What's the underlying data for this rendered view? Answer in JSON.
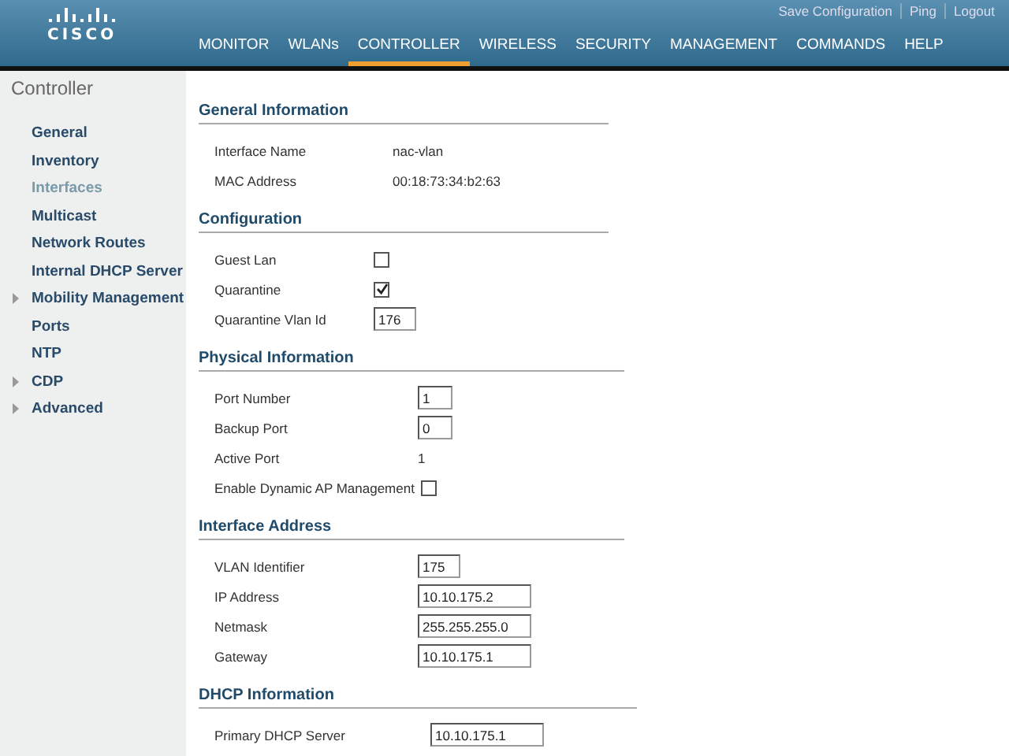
{
  "header": {
    "logo": "CISCO",
    "links": [
      "Save Configuration",
      "Ping",
      "Logout"
    ],
    "menu": [
      {
        "label": "MONITOR",
        "selected": false
      },
      {
        "label": "WLANs",
        "selected": false
      },
      {
        "label": "CONTROLLER",
        "selected": true
      },
      {
        "label": "WIRELESS",
        "selected": false
      },
      {
        "label": "SECURITY",
        "selected": false
      },
      {
        "label": "MANAGEMENT",
        "selected": false
      },
      {
        "label": "COMMANDS",
        "selected": false
      },
      {
        "label": "HELP",
        "selected": false
      }
    ]
  },
  "sidebar": {
    "title": "Controller",
    "items": [
      {
        "label": "General",
        "selected": false,
        "expandable": false
      },
      {
        "label": "Inventory",
        "selected": false,
        "expandable": false
      },
      {
        "label": "Interfaces",
        "selected": true,
        "expandable": false
      },
      {
        "label": "Multicast",
        "selected": false,
        "expandable": false
      },
      {
        "label": "Network Routes",
        "selected": false,
        "expandable": false
      },
      {
        "label": "Internal DHCP Server",
        "selected": false,
        "expandable": false
      },
      {
        "label": "Mobility Management",
        "selected": false,
        "expandable": true
      },
      {
        "label": "Ports",
        "selected": false,
        "expandable": false
      },
      {
        "label": "NTP",
        "selected": false,
        "expandable": false
      },
      {
        "label": "CDP",
        "selected": false,
        "expandable": true
      },
      {
        "label": "Advanced",
        "selected": false,
        "expandable": true
      }
    ]
  },
  "sections": [
    {
      "title": "General Information",
      "rows": [
        {
          "kind": "text",
          "label": "Interface Name",
          "value": "nac-vlan"
        },
        {
          "kind": "text",
          "label": "MAC Address",
          "value": "00:18:73:34:b2:63"
        }
      ]
    },
    {
      "title": "Configuration",
      "rows": [
        {
          "kind": "checkbox",
          "label": "Guest Lan",
          "checked": false
        },
        {
          "kind": "checkbox",
          "label": "Quarantine",
          "checked": true
        },
        {
          "kind": "input",
          "label": "Quarantine Vlan Id",
          "value": "176"
        }
      ]
    },
    {
      "title": "Physical Information",
      "rows": [
        {
          "kind": "input",
          "label": "Port Number",
          "value": "1"
        },
        {
          "kind": "input",
          "label": "Backup Port",
          "value": "0"
        },
        {
          "kind": "text",
          "label": "Active Port",
          "value": "1"
        },
        {
          "kind": "checkbox",
          "label": "Enable Dynamic AP Management",
          "checked": false
        }
      ]
    },
    {
      "title": "Interface Address",
      "rows": [
        {
          "kind": "input",
          "label": "VLAN Identifier",
          "value": "175"
        },
        {
          "kind": "input",
          "label": "IP Address",
          "value": "10.10.175.2"
        },
        {
          "kind": "input",
          "label": "Netmask",
          "value": "255.255.255.0"
        },
        {
          "kind": "input",
          "label": "Gateway",
          "value": "10.10.175.1"
        }
      ]
    },
    {
      "title": "DHCP Information",
      "rows": [
        {
          "kind": "input",
          "label": "Primary DHCP Server",
          "value": "10.10.175.1"
        }
      ]
    }
  ]
}
